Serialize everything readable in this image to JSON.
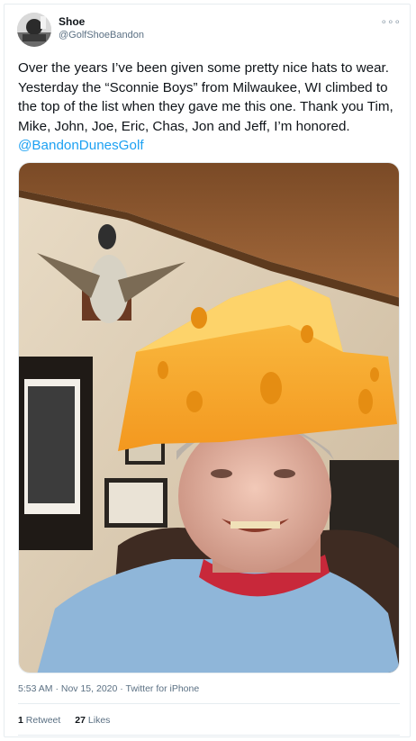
{
  "tweet": {
    "author_name": "Shoe",
    "author_handle": "@GolfShoeBandon",
    "more_icon": "more-horizontal-icon",
    "text_before_mention": "Over the years I’ve  been given some pretty nice hats to wear. Yesterday the “Sconnie Boys” from Milwaukee, WI climbed to the top of the list when they gave me this one. Thank you Tim, Mike, John, Joe, Eric, Chas, Jon and Jeff, I’m honored. ",
    "mention": "@BandonDunesGolf",
    "time": "5:53 AM",
    "separator1": " · ",
    "date": "Nov 15, 2020",
    "separator2": " · ",
    "source": "Twitter for iPhone",
    "retweets_count": "1",
    "retweets_label": "Retweet",
    "likes_count": "27",
    "likes_label": "Likes"
  },
  "colors": {
    "link": "#1da1f2",
    "secondary_text": "#5b7083",
    "cheese": "#f7a528"
  }
}
